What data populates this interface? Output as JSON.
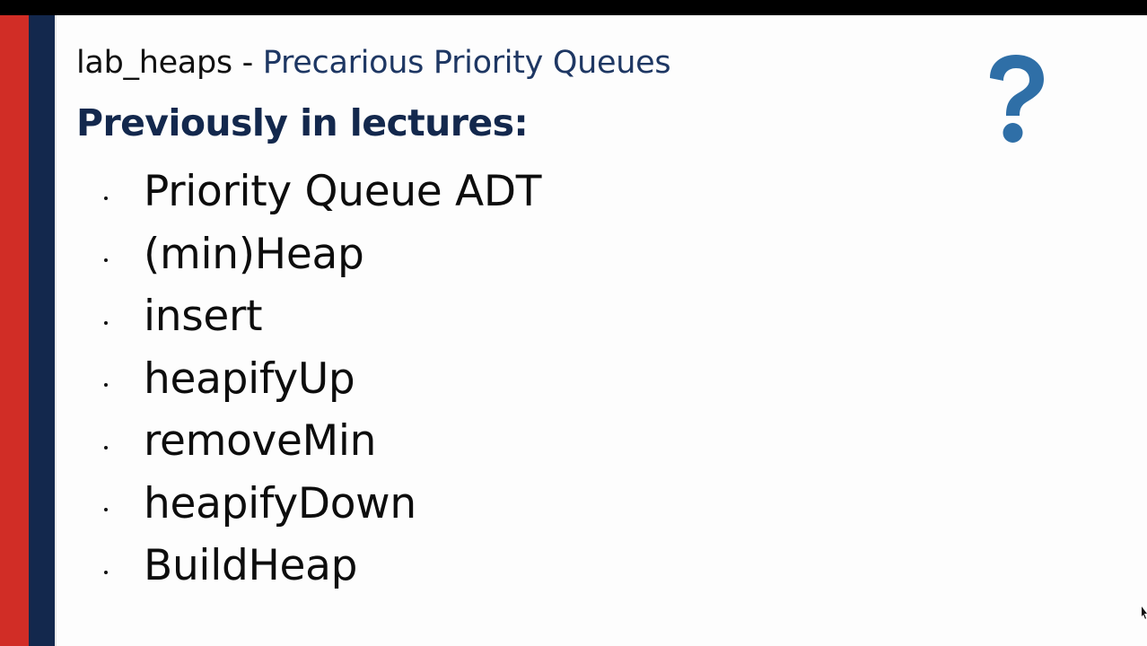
{
  "colors": {
    "accent_red": "#d12d26",
    "accent_navy": "#13284d",
    "heading": "#13284d",
    "title_name": "#1e3763",
    "qmark": "#2f6fa7"
  },
  "slide": {
    "title_prefix": "lab_heaps",
    "title_separator": " - ",
    "title_name": "Precarious Priority Queues",
    "heading": "Previously in lectures:",
    "bullets": [
      "Priority Queue ADT",
      "(min)Heap",
      "insert",
      "heapifyUp",
      "removeMin",
      "heapifyDown",
      "BuildHeap"
    ],
    "icon": "question-mark-icon"
  }
}
